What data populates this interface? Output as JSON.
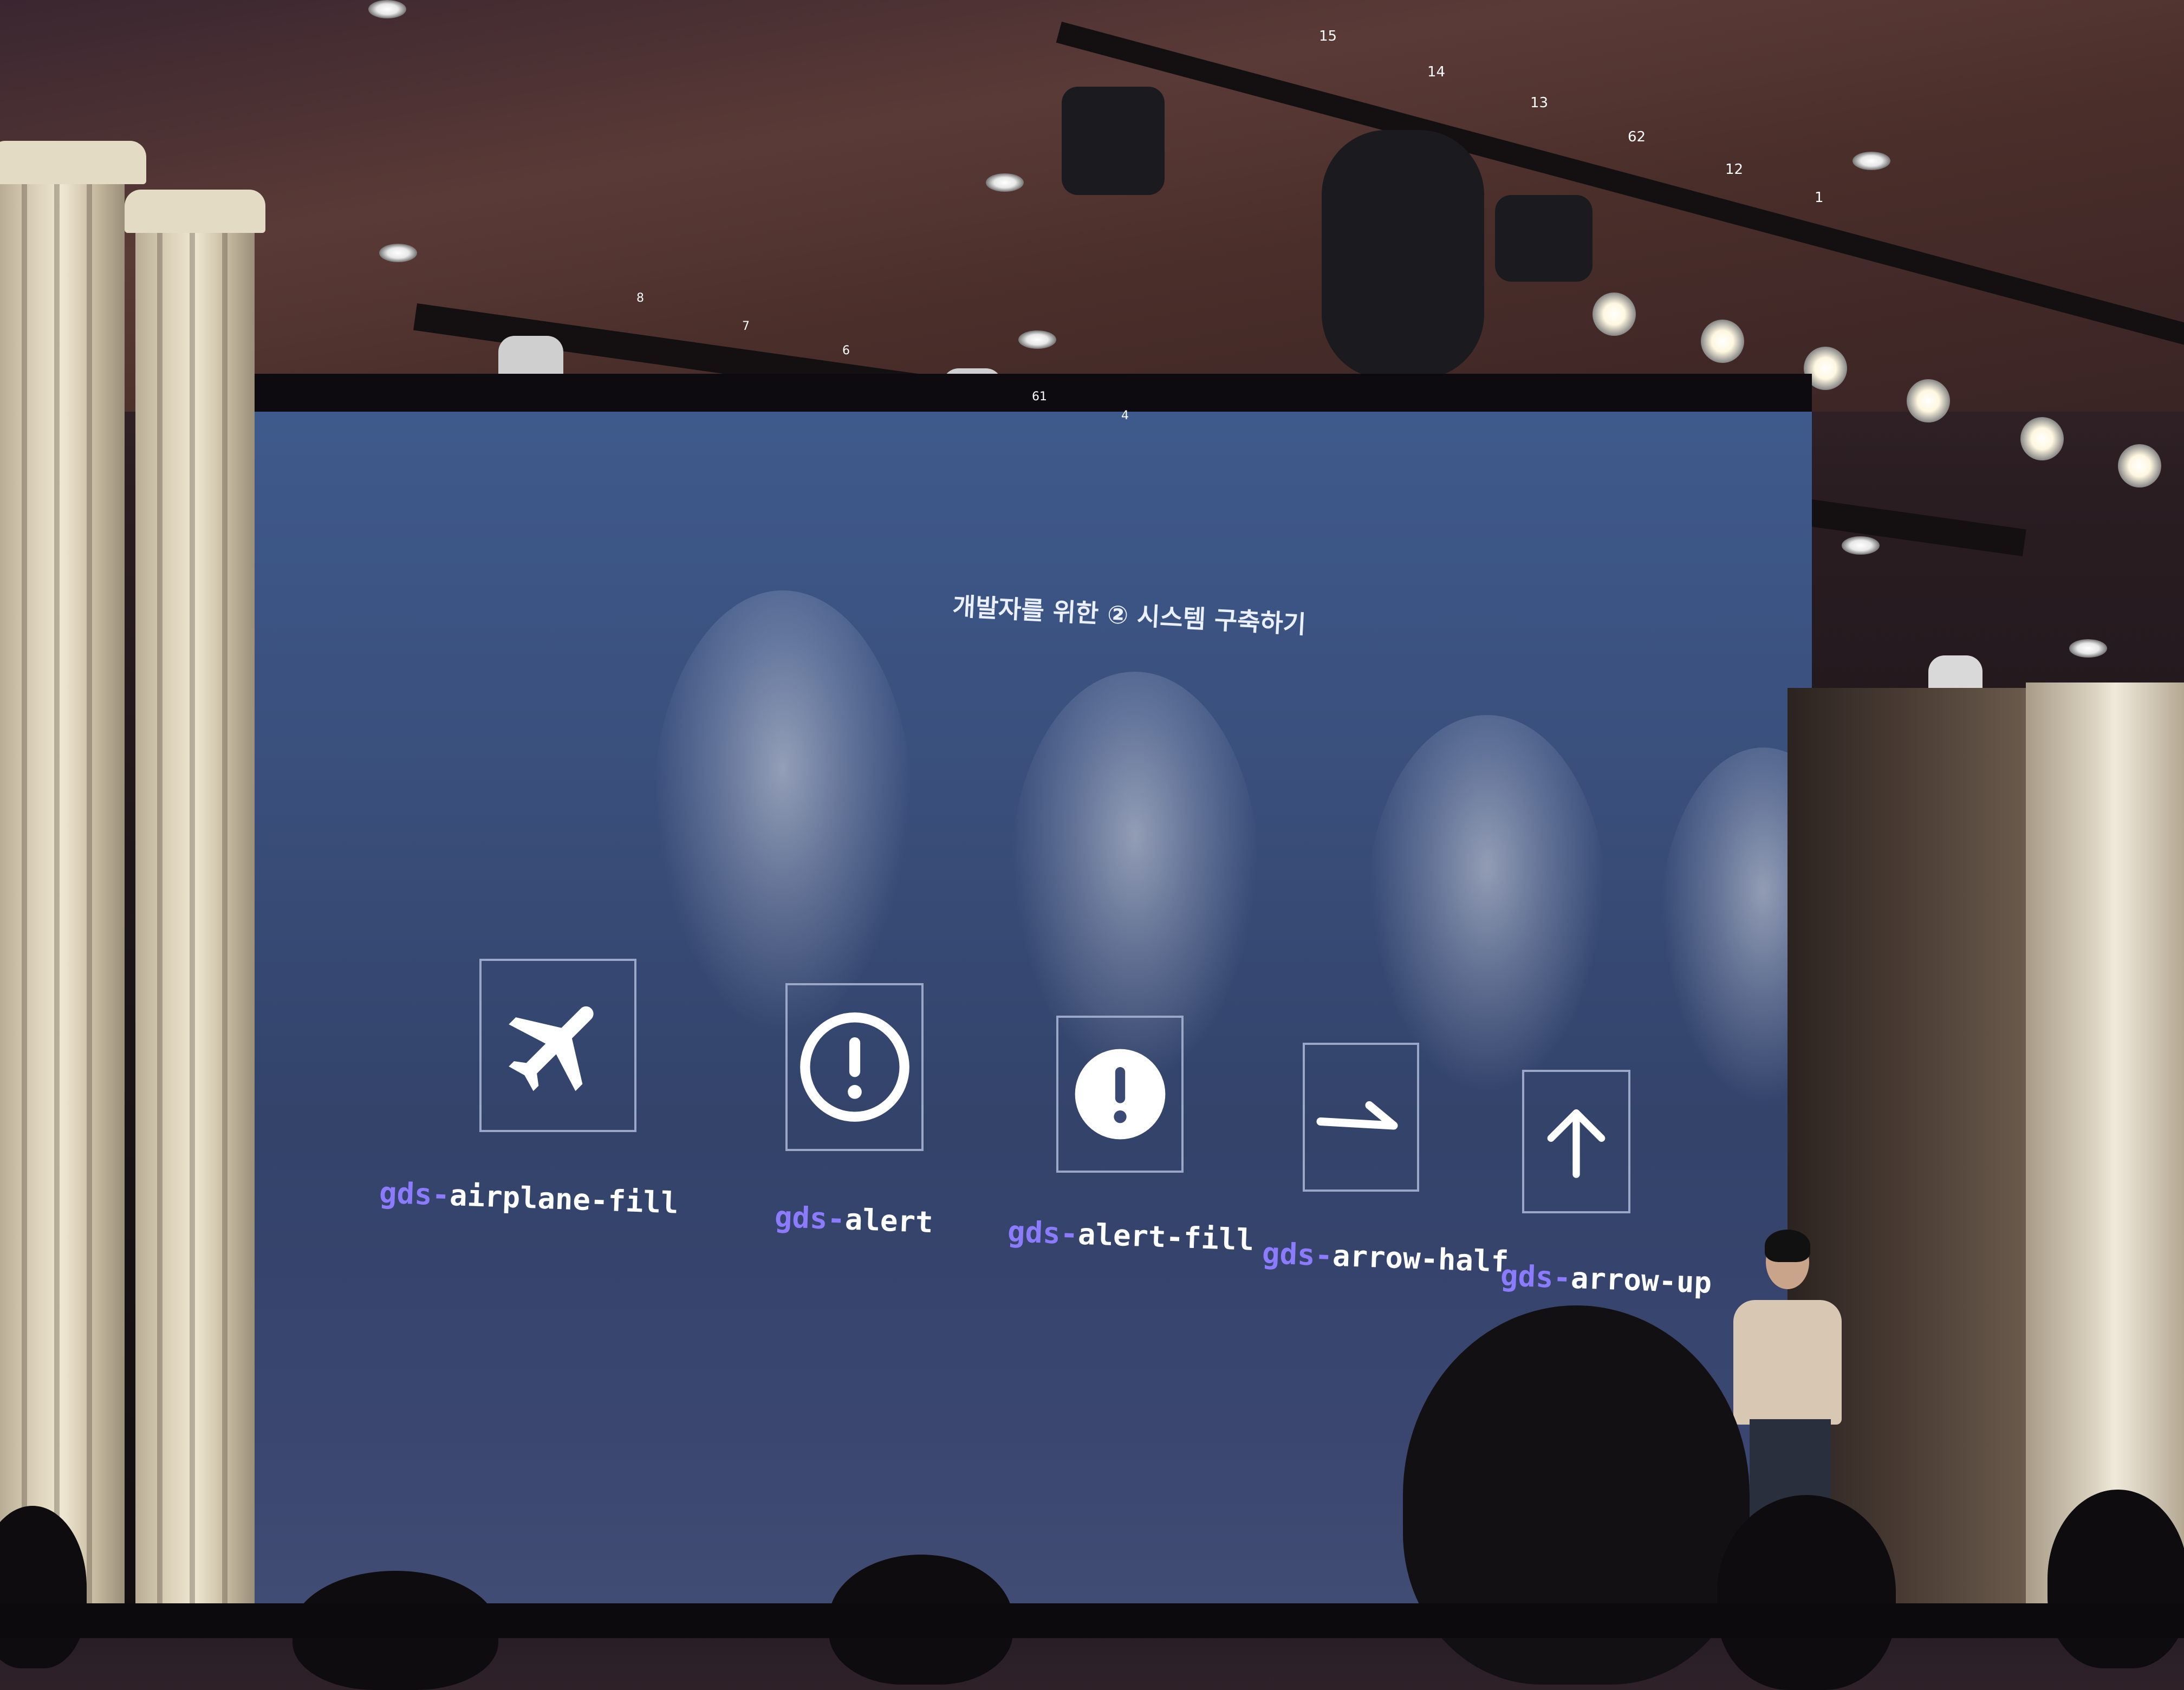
{
  "slide": {
    "title": "개발자를 위한 ② 시스템 구축하기",
    "icons": [
      {
        "prefix": "gds-",
        "name": "airplane-fill",
        "icon": "airplane-fill-icon"
      },
      {
        "prefix": "gds-",
        "name": "alert",
        "icon": "alert-outline-icon"
      },
      {
        "prefix": "gds-",
        "name": "alert-fill",
        "icon": "alert-fill-icon"
      },
      {
        "prefix": "gds-",
        "name": "arrow-half",
        "icon": "arrow-half-icon"
      },
      {
        "prefix": "gds-",
        "name": "arrow-up",
        "icon": "arrow-up-icon"
      }
    ]
  },
  "lighting_truss_numbers": [
    "8",
    "7",
    "6",
    "61",
    "4",
    "15",
    "14",
    "13",
    "62",
    "12",
    "1"
  ],
  "colors": {
    "screen": "#3a4f7c",
    "label_prefix": "#8d7bff",
    "label_name": "#ffffff",
    "icon_frame": "#9ba7c8"
  }
}
